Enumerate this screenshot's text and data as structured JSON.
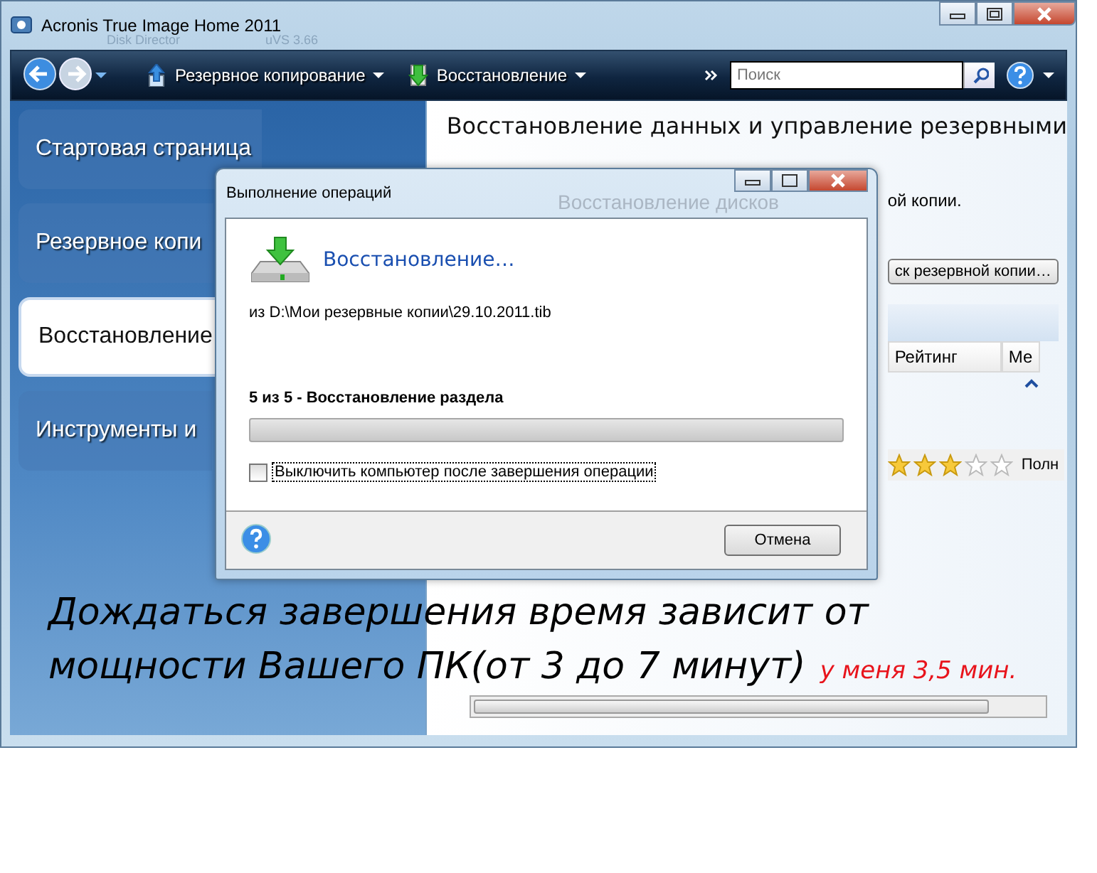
{
  "window": {
    "title": "Acronis True Image Home 2011",
    "desktop_labels": [
      "Disk Director",
      "uVS 3.66"
    ]
  },
  "toolbar": {
    "items": [
      {
        "label": "Резервное копирование",
        "kind": "backup"
      },
      {
        "label": "Восстановление",
        "kind": "restore"
      }
    ],
    "search": {
      "placeholder": "Поиск"
    }
  },
  "sidebar": {
    "items": [
      {
        "label": "Стартовая страница",
        "selected": false
      },
      {
        "label": "Резервное копи",
        "selected": false
      },
      {
        "label": "Восстановление",
        "selected": true
      },
      {
        "label": "Инструменты и",
        "selected": false
      }
    ]
  },
  "content": {
    "heading": "Восстановление данных и управление резервными",
    "faded_title": "Восстановление дисков",
    "note": "ой копии.",
    "browse_button": "ск резервной копии…",
    "columns": [
      "Рейтинг",
      "Ме"
    ],
    "row": {
      "stars": 3,
      "column_2": "Полн"
    }
  },
  "dialog": {
    "title": "Выполнение операций",
    "heading": "Восстановление…",
    "source": "из D:\\Мои резервные копии\\29.10.2011.tib",
    "step": "5 из 5 - Восстановление раздела",
    "progress": {
      "level": 0
    },
    "shutdown": {
      "label": "Выключить компьютер после завершения операции",
      "checked": false
    },
    "cancel": "Отмена"
  },
  "annotation": {
    "lines": [
      "Дождаться завершения время зависит от",
      "мощности Вашего ПК(от 3 до 7 минут)"
    ],
    "aside": "у меня 3,5 мин."
  }
}
